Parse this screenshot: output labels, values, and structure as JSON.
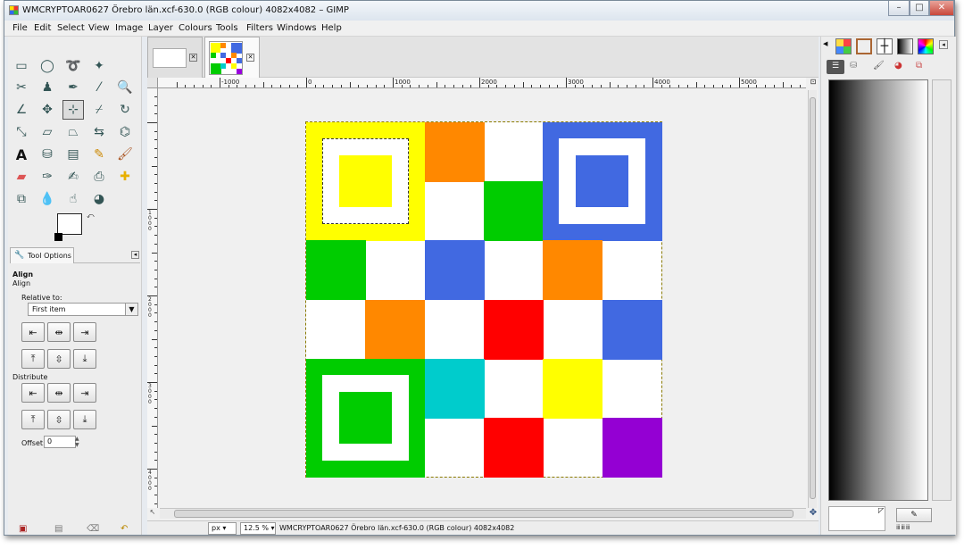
{
  "window": {
    "title": "WMCRYPTOAR0627 Örebro län.xcf-630.0 (RGB colour) 4082x4082 – GIMP",
    "minimize": "–",
    "maximize": "□",
    "close": "✕"
  },
  "menu": [
    "File",
    "Edit",
    "Select",
    "View",
    "Image",
    "Layer",
    "Colours",
    "Tools",
    "Filters",
    "Windows",
    "Help"
  ],
  "toolbox": {
    "tool_options_tab": "Tool Options",
    "align_title": "Align",
    "align_subtitle": "Align",
    "relative_to_label": "Relative to:",
    "relative_to_value": "First item",
    "distribute_label": "Distribute",
    "offset_label": "Offset:",
    "offset_value": "0"
  },
  "ruler": {
    "h_labels": [
      "-1000",
      "0",
      "1000",
      "2000",
      "3000",
      "4000",
      "5000"
    ],
    "v_labels": [
      "1000",
      "2000",
      "3000",
      "4000"
    ]
  },
  "statusbar": {
    "unit": "px",
    "zoom": "12.5 %",
    "info": "WMCRYPTOAR0627 Örebro län.xcf-630.0 (RGB colour) 4082x4082"
  },
  "colors": {
    "yellow": "#ffff00",
    "orange": "#ff8800",
    "green": "#00cc00",
    "blue": "#4169e1",
    "red": "#ff0000",
    "cyan": "#00cccc",
    "purple": "#9400d3",
    "white": "#ffffff"
  }
}
